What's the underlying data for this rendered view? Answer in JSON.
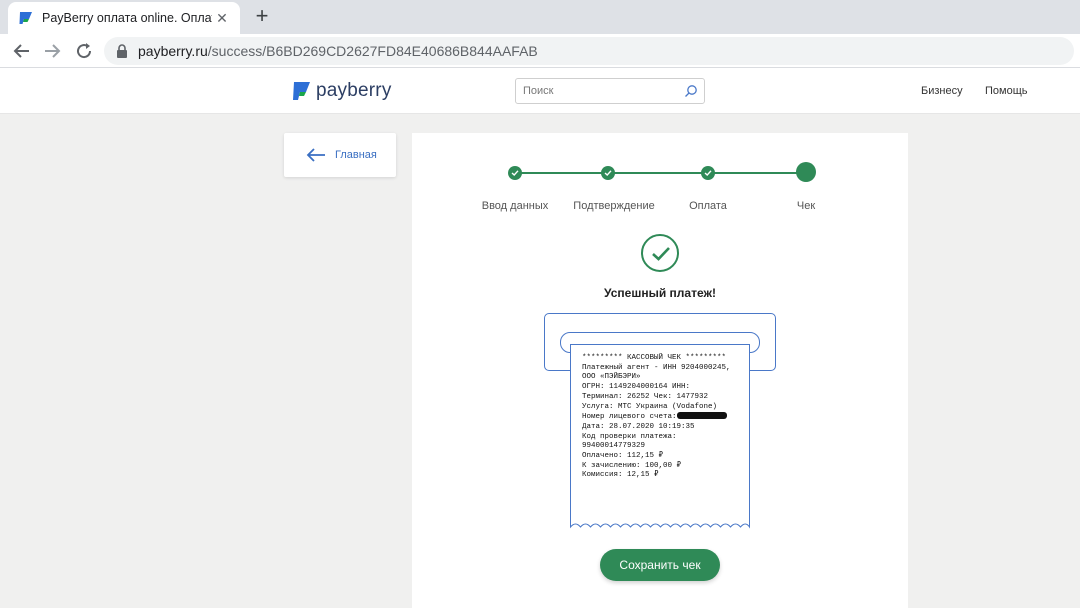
{
  "browser": {
    "tab_title": "PayBerry оплата online. Оплата з",
    "url_host": "payberry.ru",
    "url_path": "/success/B6BD269CD2627FD84E40686B844AAFAB"
  },
  "header": {
    "logo_text": "payberry",
    "search_placeholder": "Поиск",
    "nav": [
      "Бизнесу",
      "Помощь"
    ]
  },
  "back": {
    "label": "Главная"
  },
  "stepper": {
    "steps": [
      {
        "label": "Ввод данных",
        "state": "done"
      },
      {
        "label": "Подтверждение",
        "state": "done"
      },
      {
        "label": "Оплата",
        "state": "done"
      },
      {
        "label": "Чек",
        "state": "current"
      }
    ]
  },
  "status": {
    "title": "Успешный платеж!"
  },
  "receipt": {
    "lines": [
      "********* КАССОВЫЙ ЧЕК *********",
      "Платежный агент - ИНН 9204000245,",
      "ООО «ПЭЙБЭРИ»",
      "ОГРН: 1149204000164 ИНН:",
      "Терминал: 26252 Чек: 1477932",
      "Услуга: МТС Украина (Vodafone)",
      "Номер лицевого счета:",
      "Дата: 28.07.2020 10:19:35",
      "Код проверки платежа:",
      "99400014779329",
      "Оплачено: 112,15 ₽",
      "К зачислению: 100,00 ₽",
      "Комиссия: 12,15 ₽"
    ]
  },
  "actions": {
    "save_label": "Сохранить чек"
  },
  "colors": {
    "accent_green": "#2f8a57",
    "outline_blue": "#4a78c8",
    "link_blue": "#3a6fc2"
  }
}
